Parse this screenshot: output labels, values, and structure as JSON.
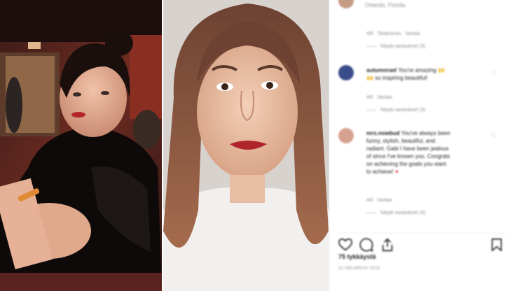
{
  "header": {
    "location": "Orlando, Florida"
  },
  "comments": [
    {
      "meta_likes": "49l",
      "meta_reply": "Tietäminen",
      "meta_more": "Vastaa",
      "view_replies": "Näytä vastaukset (3)"
    },
    {
      "username": "autumnrael",
      "text_1": "You're amazing",
      "emoji_1": "🙌",
      "text_2": "so inspiring beautiful!",
      "emoji_2": "🙌",
      "meta_likes": "40l",
      "meta_reply": "Vastaa",
      "view_replies": "Näytä vastaukset (3)"
    },
    {
      "username": "mrs.nowbud",
      "lines": [
        "You've always been",
        "funny, stylish, beautiful, and",
        "radiant. Gabi I have been jealous",
        "of since I've known you. Congrats",
        "on achieving the goals you want",
        "to achieve!"
      ],
      "heart": "♥",
      "meta_likes": "40l",
      "meta_reply": "Vastaa",
      "view_replies": "Näytä vastaukset (4)"
    }
  ],
  "footer": {
    "likes": "75 tykkäystä",
    "date": "21 HELMIKUU 2019"
  },
  "icons": {
    "like": "heart-outline-icon",
    "comment": "comment-bubble-icon",
    "share": "share-icon",
    "save": "bookmark-icon"
  },
  "colors": {
    "text": "#262626",
    "muted": "#8e8e8e",
    "like_red": "#ed4956",
    "highlight": "#d9a73b"
  }
}
